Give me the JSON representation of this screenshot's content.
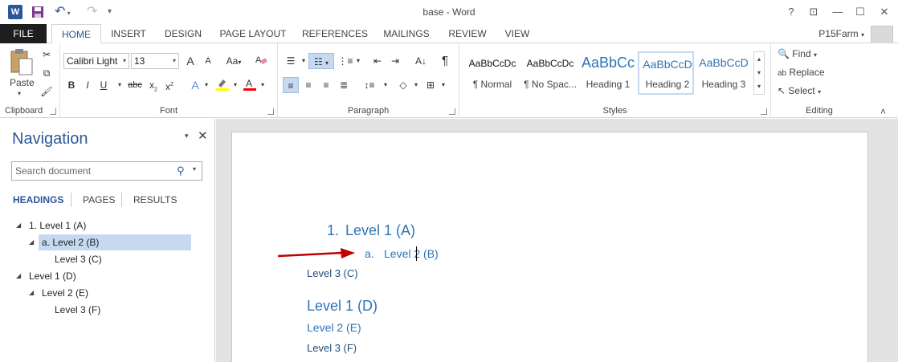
{
  "window": {
    "title": "base - Word",
    "app_icon": "W"
  },
  "qat": {
    "undo_icon": "↶",
    "redo_icon": "↷",
    "more_icon": "▾"
  },
  "winbuttons": {
    "help": "?",
    "ribbon_display": "⊡",
    "minimize": "—",
    "restore": "☐",
    "close": "✕"
  },
  "tabs": [
    "FILE",
    "HOME",
    "INSERT",
    "DESIGN",
    "PAGE LAYOUT",
    "REFERENCES",
    "MAILINGS",
    "REVIEW",
    "VIEW"
  ],
  "user": {
    "name": "P15Farm"
  },
  "clipboard": {
    "paste_label": "Paste",
    "group_label": "Clipboard"
  },
  "font": {
    "name": "Calibri Light",
    "size": "13",
    "group_label": "Font",
    "grow": "A",
    "shrink": "A",
    "case": "Aa",
    "bold": "B",
    "italic": "I",
    "underline": "U",
    "strike": "abc",
    "subscript": "x",
    "superscript": "x",
    "highlight_color": "#ffff00",
    "font_color": "#ff0000"
  },
  "paragraph": {
    "group_label": "Paragraph",
    "pilcrow": "¶"
  },
  "styles": {
    "group_label": "Styles",
    "items": [
      {
        "sample": "AaBbCcDc",
        "name": "¶ Normal"
      },
      {
        "sample": "AaBbCcDc",
        "name": "¶ No Spac..."
      },
      {
        "sample": "AaBbCc",
        "name": "Heading 1"
      },
      {
        "sample": "AaBbCcD",
        "name": "Heading 2"
      },
      {
        "sample": "AaBbCcD",
        "name": "Heading 3"
      }
    ]
  },
  "editing": {
    "find": "Find",
    "replace": "Replace",
    "select": "Select",
    "group_label": "Editing"
  },
  "nav": {
    "title": "Navigation",
    "search_placeholder": "Search document",
    "tabs": [
      "HEADINGS",
      "PAGES",
      "RESULTS"
    ],
    "tree": [
      {
        "label": "1. Level 1 (A)"
      },
      {
        "label": "a. Level 2 (B)"
      },
      {
        "label": "Level 3 (C)"
      },
      {
        "label": "Level 1 (D)"
      },
      {
        "label": "Level 2 (E)"
      },
      {
        "label": "Level 3 (F)"
      }
    ]
  },
  "doc": {
    "lines": [
      {
        "num": "1.",
        "text": "Level 1 (A)"
      },
      {
        "num": "a.",
        "text": "Level 2 (B)"
      },
      {
        "text": "Level 3 (C)"
      },
      {
        "text": "Level 1 (D)"
      },
      {
        "text": "Level 2 (E)"
      },
      {
        "text": "Level 3 (F)"
      }
    ],
    "accent": "#2e74b5",
    "arrow_color": "#c00000"
  }
}
